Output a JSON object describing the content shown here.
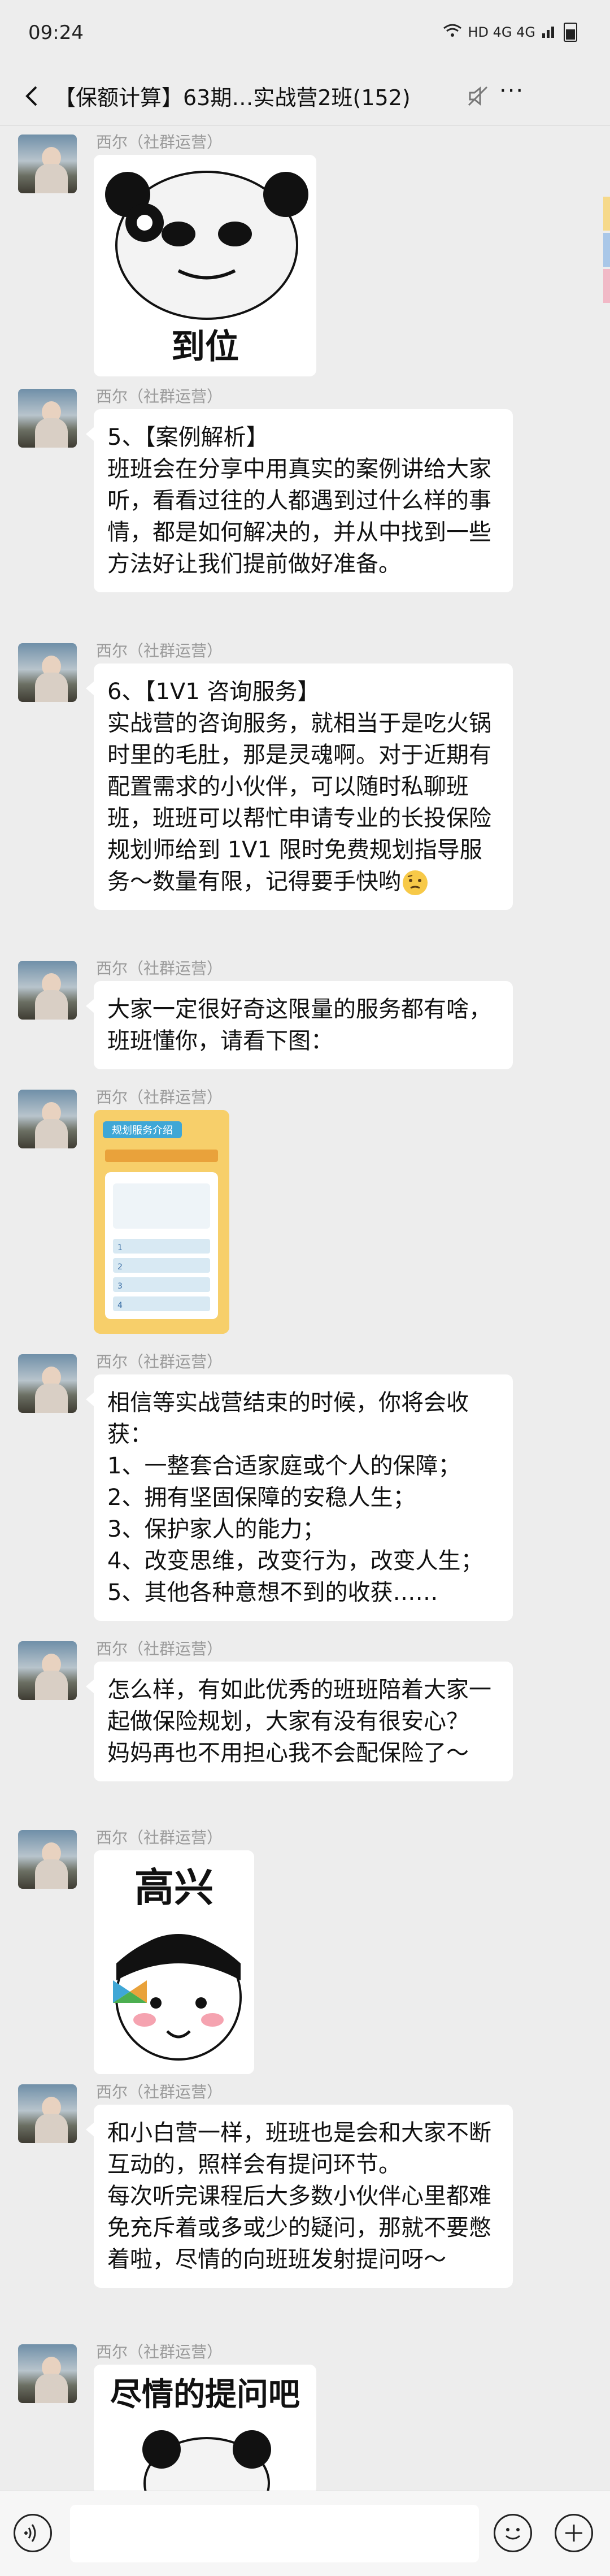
{
  "status_bar": {
    "time": "09:24",
    "network": "HD 4G 4G"
  },
  "header": {
    "title": "【保额计算】63期…实战营2班(152)"
  },
  "colors": {
    "background": "#ededed",
    "bubble": "#ffffff",
    "sender": "#9a9a9a",
    "edge_tabs": [
      "#f6d98a",
      "#a9c7e8",
      "#f2b8c6"
    ]
  },
  "messages": [
    {
      "type": "sticker",
      "sender": "西尔（社群运营）",
      "caption": "到位",
      "icon": "panda-ok-sticker"
    },
    {
      "type": "text",
      "sender": "西尔（社群运营）",
      "text": "5、【案例解析】\n班班会在分享中用真实的案例讲给大家听，看看过往的人都遇到过什么样的事情，都是如何解决的，并从中找到一些方法好让我们提前做好准备。"
    },
    {
      "type": "text",
      "sender": "西尔（社群运营）",
      "text": "6、【1V1 咨询服务】\n实战营的咨询服务，就相当于是吃火锅时里的毛肚，那是灵魂啊。对于近期有配置需求的小伙伴，可以随时私聊班班，班班可以帮忙申请专业的长投保险规划师给到 1V1 限时免费规划指导服务～数量有限，记得要手快哟",
      "trailing_icon": "thinking-emoji"
    },
    {
      "type": "text",
      "sender": "西尔（社群运营）",
      "text": "大家一定很好奇这限量的服务都有啥，班班懂你，请看下图："
    },
    {
      "type": "image",
      "sender": "西尔（社群运营）",
      "title": "规划服务介绍",
      "items": [
        "1",
        "2",
        "3",
        "4"
      ]
    },
    {
      "type": "text",
      "sender": "西尔（社群运营）",
      "text": "相信等实战营结束的时候，你将会收获：\n1、一整套合适家庭或个人的保障；\n2、拥有坚固保障的安稳人生；\n3、保护家人的能力；\n4、改变思维，改变行为，改变人生；\n5、其他各种意想不到的收获……"
    },
    {
      "type": "text",
      "sender": "西尔（社群运营）",
      "text": "怎么样，有如此优秀的班班陪着大家一起做保险规划，大家有没有很安心？\n妈妈再也不用担心我不会配保险了～"
    },
    {
      "type": "sticker",
      "sender": "西尔（社群运营）",
      "caption": "高兴",
      "icon": "happy-sticker"
    },
    {
      "type": "text",
      "sender": "西尔（社群运营）",
      "text": "和小白营一样，班班也是会和大家不断互动的，照样会有提问环节。\n每次听完课程后大多数小伙伴心里都难免充斥着或多或少的疑问，那就不要憋着啦，尽情的向班班发射提问呀～"
    },
    {
      "type": "sticker",
      "sender": "西尔（社群运营）",
      "caption": "尽情的提问吧",
      "icon": "question-sticker"
    }
  ],
  "input_bar": {
    "placeholder": ""
  }
}
